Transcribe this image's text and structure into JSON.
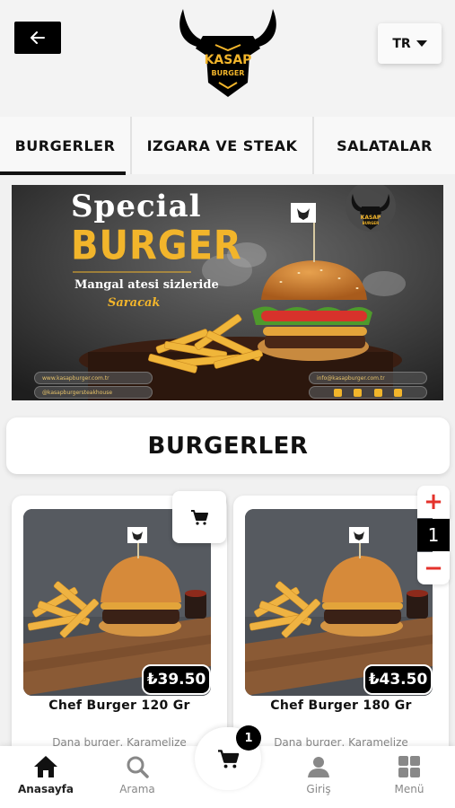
{
  "header": {
    "back_icon": "arrow-left-icon",
    "logo_text_top": "KASAP",
    "logo_text_bottom": "BURGER",
    "language": "TR"
  },
  "tabs": [
    {
      "label": "BURGERLER",
      "active": true
    },
    {
      "label": "IZGARA VE STEAK",
      "active": false
    },
    {
      "label": "SALATALAR",
      "active": false
    }
  ],
  "banner": {
    "title_line1": "Special",
    "title_line2": "BURGER",
    "subtitle_line1": "Mangal atesi sizleride",
    "subtitle_line2": "Saracak",
    "website": "www.kasapburger.com.tr",
    "instagram": "@kasapburgersteakhouse",
    "email": "info@kasapburger.com.tr",
    "logo_text_top": "KASAP",
    "logo_text_bottom": "BURGER"
  },
  "section": {
    "title": "BURGERLER"
  },
  "products": [
    {
      "name": "Chef Burger 120 Gr",
      "price": "₺39.50",
      "description": "Dana burger, Karamelize"
    },
    {
      "name": "Chef Burger 180 Gr",
      "price": "₺43.50",
      "description": "Dana burger, Karamelize"
    }
  ],
  "stepper": {
    "plus": "+",
    "value": "1",
    "minus": "−"
  },
  "bottom_nav": {
    "home": "Anasayfa",
    "search": "Arama",
    "login": "Giriş",
    "menu": "Menü",
    "cart_count": "1"
  },
  "colors": {
    "accent_gold": "#f2b52b",
    "stepper_red": "#e4322b",
    "black": "#000000"
  }
}
